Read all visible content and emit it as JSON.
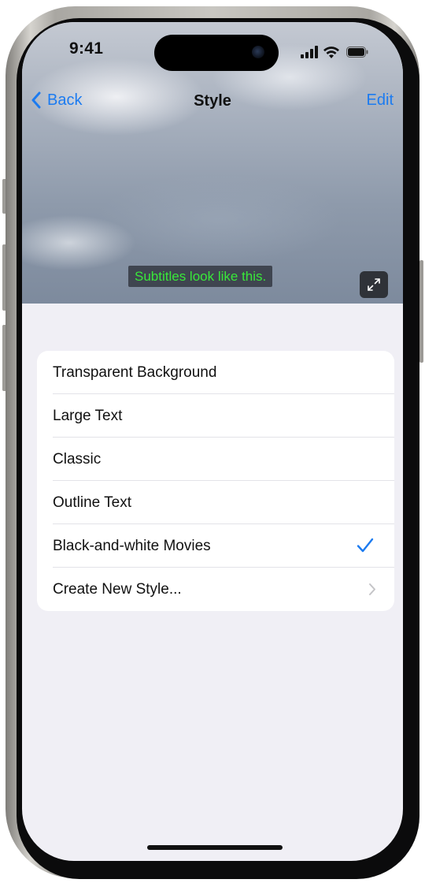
{
  "status_bar": {
    "time": "9:41",
    "icons": [
      "cellular-signal-icon",
      "wifi-icon",
      "battery-icon"
    ]
  },
  "nav": {
    "back_label": "Back",
    "title": "Style",
    "edit_label": "Edit"
  },
  "preview": {
    "subtitle_text": "Subtitles look like this.",
    "subtitle_color": "#39e83a",
    "expand_icon": "expand-arrows-icon"
  },
  "styles": {
    "items": [
      {
        "label": "Transparent Background",
        "selected": false
      },
      {
        "label": "Large Text",
        "selected": false
      },
      {
        "label": "Classic",
        "selected": false
      },
      {
        "label": "Outline Text",
        "selected": false
      },
      {
        "label": "Black-and-white Movies",
        "selected": true
      },
      {
        "label": "Create New Style...",
        "accessory": "chevron-right-icon"
      }
    ]
  },
  "colors": {
    "accent": "#1c7bf0",
    "background": "#f0eff5",
    "cell": "#ffffff"
  }
}
